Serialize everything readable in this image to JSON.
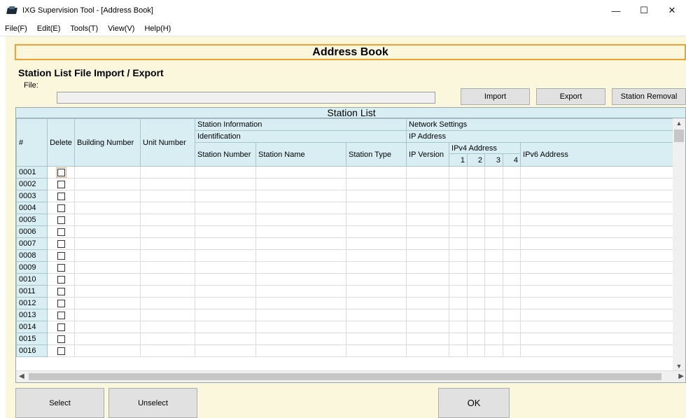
{
  "window": {
    "title": "IXG Supervision Tool - [Address Book]",
    "controls": {
      "minimize": "—",
      "maximize": "☐",
      "close": "✕"
    }
  },
  "menu": [
    "File(F)",
    "Edit(E)",
    "Tools(T)",
    "View(V)",
    "Help(H)"
  ],
  "header": {
    "title": "Address Book"
  },
  "import_export": {
    "section_title": "Station List File Import / Export",
    "file_label": "File:",
    "file_value": "",
    "import_label": "Import",
    "export_label": "Export",
    "removal_label": "Station Removal"
  },
  "station_list": {
    "title": "Station List",
    "headers": {
      "num": "#",
      "delete": "Delete",
      "building_number": "Building Number",
      "unit_number": "Unit Number",
      "station_information": "Station Information",
      "identification": "Identification",
      "station_number": "Station Number",
      "station_name": "Station Name",
      "station_type": "Station Type",
      "network_settings": "Network Settings",
      "ip_address": "IP Address",
      "ip_version": "IP Version",
      "ipv4_address": "IPv4 Address",
      "ipv4_1": "1",
      "ipv4_2": "2",
      "ipv4_3": "3",
      "ipv4_4": "4",
      "ipv6_address": "IPv6 Address"
    },
    "rows": [
      "0001",
      "0002",
      "0003",
      "0004",
      "0005",
      "0006",
      "0007",
      "0008",
      "0009",
      "0010",
      "0011",
      "0012",
      "0013",
      "0014",
      "0015",
      "0016"
    ]
  },
  "footer": {
    "select_label": "Select",
    "unselect_label": "Unselect",
    "ok_label": "OK"
  },
  "colors": {
    "background": "#fbf7dc",
    "header_border": "#f0a030",
    "grid_header": "#d8eef3"
  }
}
